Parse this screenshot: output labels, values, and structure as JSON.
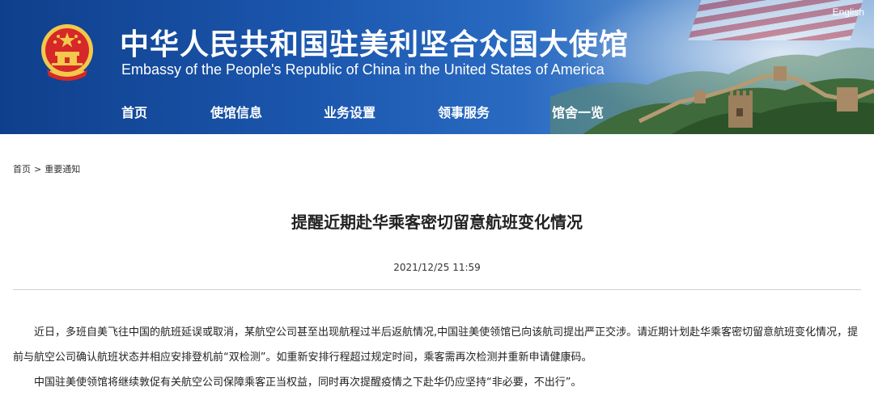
{
  "header": {
    "title_zh": "中华人民共和国驻美利坚合众国大使馆",
    "title_en": "Embassy of the People's Republic of China in the United States of America",
    "lang_link": "English"
  },
  "nav": {
    "items": [
      {
        "label": "首页"
      },
      {
        "label": "使馆信息"
      },
      {
        "label": "业务设置"
      },
      {
        "label": "领事服务"
      },
      {
        "label": "馆舍一览"
      }
    ]
  },
  "breadcrumb": {
    "home": "首页",
    "separator": ">",
    "current": "重要通知"
  },
  "article": {
    "title": "提醒近期赴华乘客密切留意航班变化情况",
    "date": "2021/12/25 11:59",
    "paragraphs": [
      "近日，多班自美飞往中国的航班延误或取消，某航空公司甚至出现航程过半后返航情况,中国驻美使领馆已向该航司提出严正交涉。请近期计划赴华乘客密切留意航班变化情况，提前与航空公司确认航班状态并相应安排登机前“双检测”。如重新安排行程超过规定时间，乘客需再次检测并重新申请健康码。",
      "中国驻美使领馆将继续敦促有关航空公司保障乘客正当权益，同时再次提醒疫情之下赴华仍应坚持“非必要，不出行”。"
    ]
  }
}
